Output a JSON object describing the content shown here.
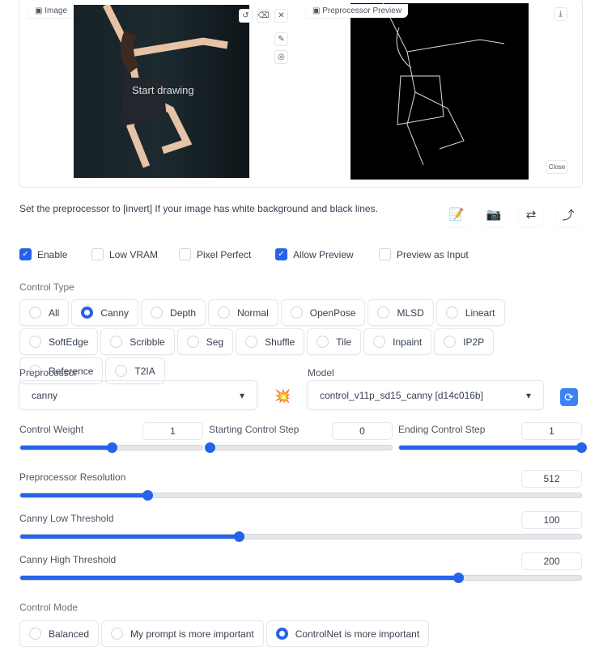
{
  "image_panel": {
    "label": "Image",
    "overlay_text": "Start drawing",
    "tools": [
      "undo-icon",
      "eraser-icon",
      "close-icon",
      "brush-icon",
      "palette-icon"
    ]
  },
  "preview_panel": {
    "label": "Preprocessor Preview",
    "close_label": "Close"
  },
  "hint": "Set the preprocessor to [invert] If your image has white background and black lines.",
  "toolbar": [
    "📝",
    "📷",
    "⇄",
    "⤴"
  ],
  "checkboxes": [
    {
      "label": "Enable",
      "checked": true
    },
    {
      "label": "Low VRAM",
      "checked": false
    },
    {
      "label": "Pixel Perfect",
      "checked": false
    },
    {
      "label": "Allow Preview",
      "checked": true
    },
    {
      "label": "Preview as Input",
      "checked": false
    }
  ],
  "control_type": {
    "label": "Control Type",
    "selected": "Canny",
    "options": [
      "All",
      "Canny",
      "Depth",
      "Normal",
      "OpenPose",
      "MLSD",
      "Lineart",
      "SoftEdge",
      "Scribble",
      "Seg",
      "Shuffle",
      "Tile",
      "Inpaint",
      "IP2P",
      "Reference",
      "T2IA"
    ]
  },
  "preprocessor": {
    "label": "Preprocessor",
    "value": "canny"
  },
  "model": {
    "label": "Model",
    "value": "control_v11p_sd15_canny [d14c016b]"
  },
  "sliders": {
    "weight": {
      "label": "Control Weight",
      "value": "1",
      "fraction": 0.5
    },
    "start": {
      "label": "Starting Control Step",
      "value": "0",
      "fraction": 0
    },
    "end": {
      "label": "Ending Control Step",
      "value": "1",
      "fraction": 1
    },
    "resolution": {
      "label": "Preprocessor Resolution",
      "value": "512",
      "fraction": 0.226
    },
    "low": {
      "label": "Canny Low Threshold",
      "value": "100",
      "fraction": 0.39
    },
    "high": {
      "label": "Canny High Threshold",
      "value": "200",
      "fraction": 0.78
    }
  },
  "control_mode": {
    "label": "Control Mode",
    "options": [
      "Balanced",
      "My prompt is more important",
      "ControlNet is more important"
    ],
    "selected": "ControlNet is more important"
  },
  "accent": "#2563eb"
}
